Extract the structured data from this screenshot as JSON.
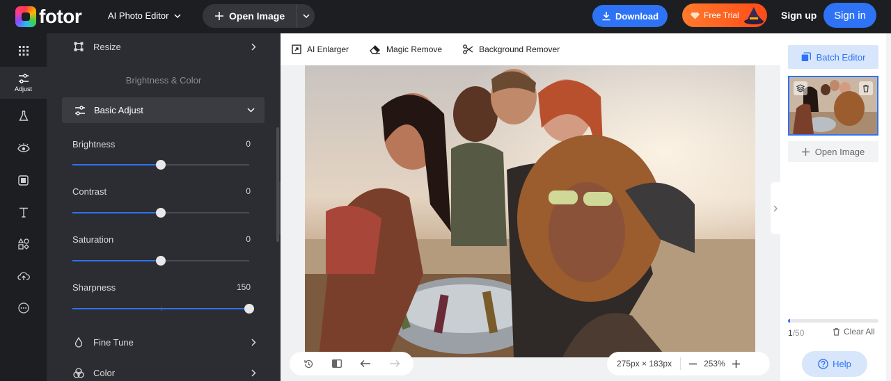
{
  "header": {
    "logo_text": "fotor",
    "app_switch_label": "AI Photo Editor",
    "open_image_label": "Open Image",
    "download_label": "Download",
    "free_trial_label": "Free Trial",
    "sign_up_label": "Sign up",
    "sign_in_label": "Sign in"
  },
  "rail": {
    "active_label": "Adjust"
  },
  "panel": {
    "resize_label": "Resize",
    "section_title": "Brightness & Color",
    "basic_adjust_label": "Basic Adjust",
    "sliders": [
      {
        "label": "Brightness",
        "value": "0",
        "level": 0.5
      },
      {
        "label": "Contrast",
        "value": "0",
        "level": 0.5
      },
      {
        "label": "Saturation",
        "value": "0",
        "level": 0.5
      },
      {
        "label": "Sharpness",
        "value": "150",
        "level": 1.0
      }
    ],
    "fine_tune_label": "Fine Tune",
    "color_label": "Color"
  },
  "tools": {
    "ai_enlarger": "AI Enlarger",
    "magic_remove": "Magic Remove",
    "background_remover": "Background Remover"
  },
  "canvas": {
    "dimensions": "275px × 183px",
    "zoom": "253%"
  },
  "sidebar": {
    "batch_editor_label": "Batch Editor",
    "open_image_label": "Open Image",
    "count_current": "1",
    "count_total": "/50",
    "progress_fraction": 0.02,
    "clear_all_label": "Clear All",
    "help_label": "Help"
  },
  "colors": {
    "accent": "#2e73f6",
    "trial_orange": "#ff5a1f",
    "panel_bg": "#2b2d32",
    "topbar_bg": "#1d1e22"
  }
}
